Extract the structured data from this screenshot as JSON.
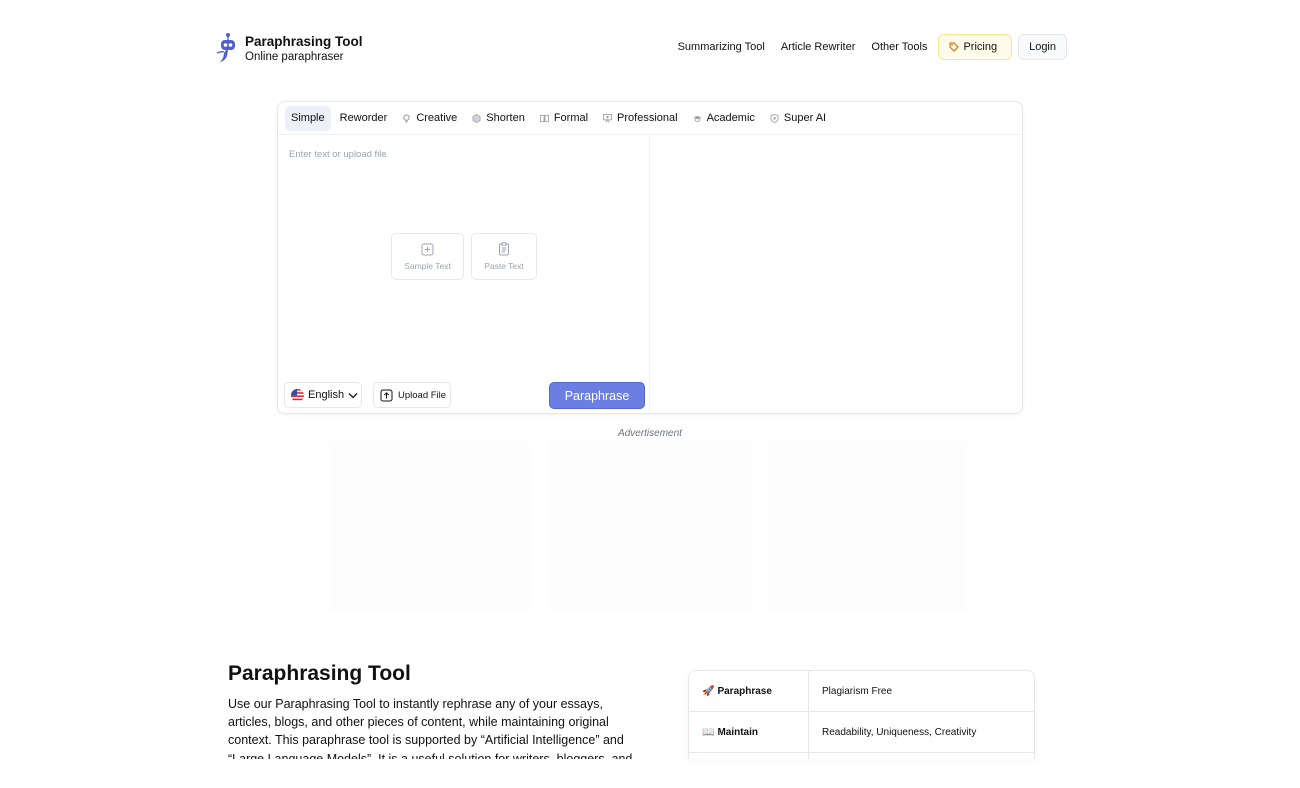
{
  "brand": {
    "title": "Paraphrasing Tool",
    "subtitle": "Online paraphraser"
  },
  "nav": {
    "summarizing": "Summarizing Tool",
    "rewriter": "Article Rewriter",
    "other": "Other Tools",
    "pricing": "Pricing",
    "login": "Login"
  },
  "modes": [
    {
      "label": "Simple",
      "icon": "none"
    },
    {
      "label": "Reworder",
      "icon": "none"
    },
    {
      "label": "Creative",
      "icon": "bulb-icon"
    },
    {
      "label": "Shorten",
      "icon": "hexagon-icon"
    },
    {
      "label": "Formal",
      "icon": "book-icon"
    },
    {
      "label": "Professional",
      "icon": "presentation-icon"
    },
    {
      "label": "Academic",
      "icon": "graduation-cap-icon"
    },
    {
      "label": "Super AI",
      "icon": "shield-ai-icon"
    }
  ],
  "editor": {
    "placeholder": "Enter text or upload file",
    "sample": "Sample Text",
    "paste": "Paste Text",
    "language": "English",
    "upload": "Upload File",
    "action": "Paraphrase"
  },
  "ad": {
    "label": "Advertisement"
  },
  "content": {
    "heading": "Paraphrasing Tool",
    "intro": "Use our Paraphrasing Tool to instantly rephrase any of your essays, articles, blogs, and other pieces of content, while maintaining original context. This paraphrase tool is supported by “Artificial Intelligence” and “Large Language Models”. It is a useful solution for writers, bloggers, and students to turn text"
  },
  "features": [
    {
      "emoji": "🚀",
      "label": "Paraphrase",
      "value": "Plagiarism Free"
    },
    {
      "emoji": "📖",
      "label": "Maintain",
      "value": "Readability, Uniqueness, Creativity"
    }
  ],
  "colors": {
    "accent": "#6b7fe3",
    "pricing_bg": "#fffbeb"
  }
}
